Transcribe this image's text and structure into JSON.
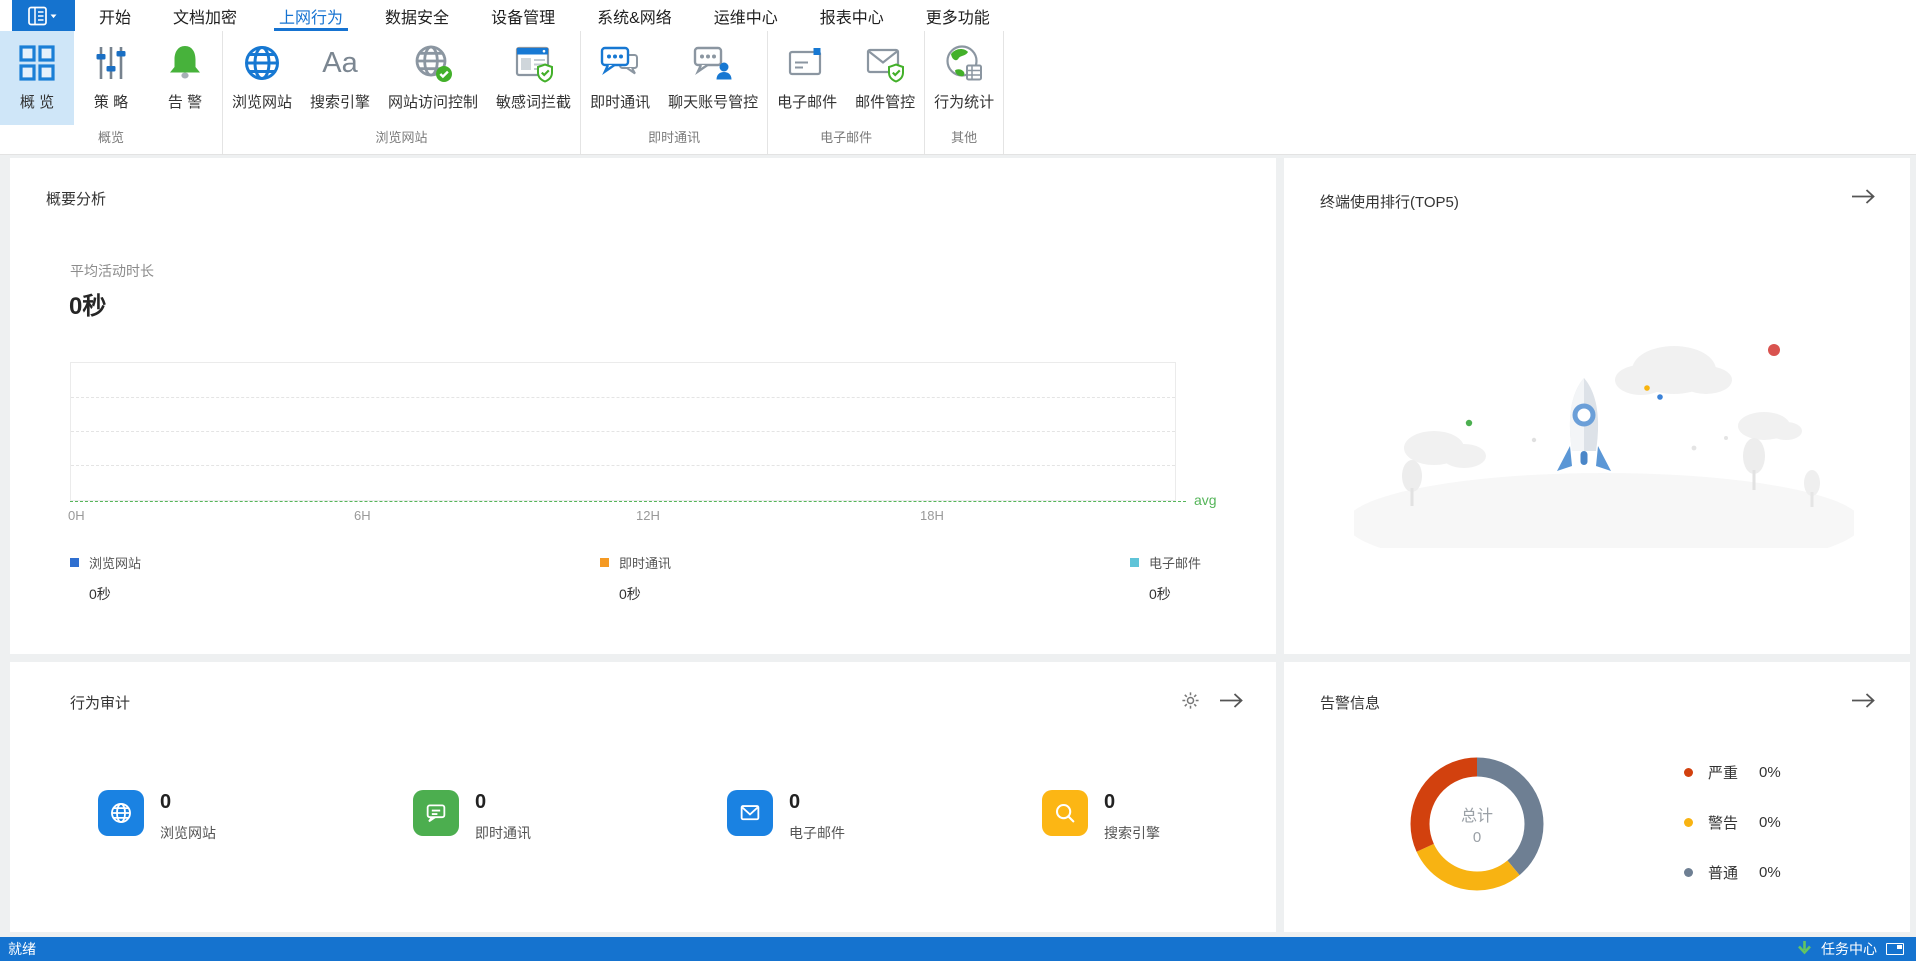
{
  "colors": {
    "primary_blue": "#1573cf",
    "selected_tile": "#cfe6f8",
    "statusbar_blue": "#1573cf",
    "green": "#4cae4f",
    "yellow": "#fcb614",
    "legend_blue": "#2f6fd0",
    "legend_orange": "#f59a23",
    "legend_cyan": "#5fc4d8",
    "donut_red": "#d2410e",
    "donut_yellow": "#f8b312",
    "donut_gray": "#6e7f93",
    "avg_green": "#55b559"
  },
  "menu": {
    "items": [
      {
        "label": "开始"
      },
      {
        "label": "文档加密"
      },
      {
        "label": "上网行为"
      },
      {
        "label": "数据安全"
      },
      {
        "label": "设备管理"
      },
      {
        "label": "系统&网络"
      },
      {
        "label": "运维中心"
      },
      {
        "label": "报表中心"
      },
      {
        "label": "更多功能"
      }
    ],
    "active_index": 2
  },
  "ribbon": {
    "groups": [
      {
        "label": "概览",
        "items": [
          {
            "label": "概 览",
            "icon": "overview-grid-icon",
            "selected": true
          },
          {
            "label": "策 略",
            "icon": "policy-sliders-icon"
          },
          {
            "label": "告 警",
            "icon": "alert-bell-icon"
          }
        ]
      },
      {
        "label": "浏览网站",
        "items": [
          {
            "label": "浏览网站",
            "icon": "browse-web-globe-icon"
          },
          {
            "label": "搜索引擎",
            "icon": "search-engine-aa-icon"
          },
          {
            "label": "网站访问控制",
            "icon": "site-access-control-icon"
          },
          {
            "label": "敏感词拦截",
            "icon": "sensitive-word-block-icon"
          }
        ]
      },
      {
        "label": "即时通讯",
        "items": [
          {
            "label": "即时通讯",
            "icon": "im-chat-icon"
          },
          {
            "label": "聊天账号管控",
            "icon": "chat-account-control-icon"
          }
        ]
      },
      {
        "label": "电子邮件",
        "items": [
          {
            "label": "电子邮件",
            "icon": "email-icon"
          },
          {
            "label": "邮件管控",
            "icon": "email-shield-icon"
          }
        ]
      },
      {
        "label": "其他",
        "items": [
          {
            "label": "行为统计",
            "icon": "behavior-stats-icon"
          }
        ]
      }
    ]
  },
  "panels": {
    "summary": {
      "title": "概要分析",
      "metric_label": "平均活动时长",
      "metric_value": "0秒",
      "axis_ticks": [
        "0H",
        "6H",
        "12H",
        "18H"
      ],
      "avg_label": "avg",
      "legend": [
        {
          "label": "浏览网站",
          "value": "0秒"
        },
        {
          "label": "即时通讯",
          "value": "0秒"
        },
        {
          "label": "电子邮件",
          "value": "0秒"
        }
      ]
    },
    "ranking": {
      "title": "终端使用排行(TOP5)"
    },
    "audit": {
      "title": "行为审计",
      "stats": [
        {
          "label": "浏览网站",
          "value": "0"
        },
        {
          "label": "即时通讯",
          "value": "0"
        },
        {
          "label": "电子邮件",
          "value": "0"
        },
        {
          "label": "搜索引擎",
          "value": "0"
        }
      ]
    },
    "alerts": {
      "title": "告警信息",
      "center_label": "总计",
      "center_value": "0",
      "legend": [
        {
          "label": "严重",
          "pct": "0%"
        },
        {
          "label": "警告",
          "pct": "0%"
        },
        {
          "label": "普通",
          "pct": "0%"
        }
      ]
    }
  },
  "statusbar": {
    "status": "就绪",
    "task_center": "任务中心"
  },
  "chart_data": [
    {
      "type": "line",
      "title": "概要分析 — 平均活动时长",
      "x_ticks": [
        "0H",
        "6H",
        "12H",
        "18H"
      ],
      "x_range_hours": [
        0,
        24
      ],
      "series": [
        {
          "name": "浏览网站",
          "total": "0秒",
          "values": [
            0,
            0,
            0,
            0,
            0
          ],
          "color": "#2f6fd0"
        },
        {
          "name": "即时通讯",
          "total": "0秒",
          "values": [
            0,
            0,
            0,
            0,
            0
          ],
          "color": "#f59a23"
        },
        {
          "name": "电子邮件",
          "total": "0秒",
          "values": [
            0,
            0,
            0,
            0,
            0
          ],
          "color": "#5fc4d8"
        }
      ],
      "avg_line": {
        "label": "avg",
        "value": 0,
        "color": "#55b559"
      },
      "grid": "dashed-horizontal",
      "legend_position": "bottom"
    },
    {
      "type": "donut",
      "title": "告警信息",
      "center_label": "总计",
      "center_value": 0,
      "segments": [
        {
          "label": "普通",
          "pct": "0%",
          "color": "#6e7f93",
          "sweep_deg": 140
        },
        {
          "label": "警告",
          "pct": "0%",
          "color": "#f8b312",
          "sweep_deg": 105
        },
        {
          "label": "严重",
          "pct": "0%",
          "color": "#d2410e",
          "sweep_deg": 115
        }
      ],
      "legend_position": "right"
    }
  ]
}
